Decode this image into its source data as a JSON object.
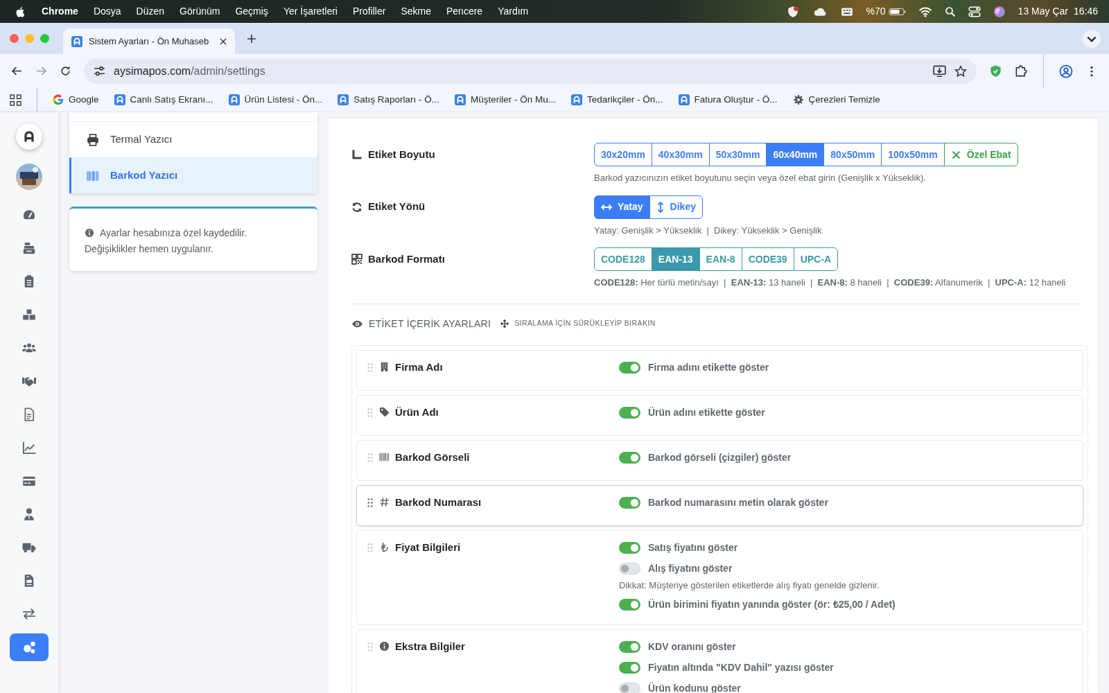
{
  "menubar": {
    "app": "Chrome",
    "menus": [
      "Dosya",
      "Düzen",
      "Görünüm",
      "Geçmiş",
      "Yer İşaretleri",
      "Profiller",
      "Sekme",
      "Pencere",
      "Yardım"
    ],
    "battery": "%70",
    "date": "13 May Çar",
    "time": "16:46"
  },
  "browser": {
    "tab_title": "Sistem Ayarları - Ön Muhaseb",
    "url_host": "aysimapos.com",
    "url_path": "/admin/settings",
    "bookmarks": [
      {
        "label": "Google",
        "kind": "google"
      },
      {
        "label": "Canlı Satış Ekranı...",
        "kind": "app"
      },
      {
        "label": "Ürün Listesi - Ön...",
        "kind": "app"
      },
      {
        "label": "Satış Raporları - Ö...",
        "kind": "app"
      },
      {
        "label": "Müşteriler - Ön Mu...",
        "kind": "app"
      },
      {
        "label": "Tedarikçiler - Ön...",
        "kind": "app"
      },
      {
        "label": "Fatura Oluştur - Ö...",
        "kind": "app"
      },
      {
        "label": "Çerezleri Temizle",
        "kind": "settings"
      }
    ]
  },
  "sidebar": {
    "items": [
      {
        "selected": false
      },
      {
        "selected": false
      },
      {
        "selected": false
      },
      {
        "selected": false
      },
      {
        "selected": false
      },
      {
        "selected": false
      },
      {
        "selected": false
      },
      {
        "selected": false
      },
      {
        "selected": false
      },
      {
        "selected": false
      },
      {
        "selected": false
      },
      {
        "selected": false
      },
      {
        "selected": false
      },
      {
        "selected": true
      }
    ]
  },
  "settings_menu": {
    "items": [
      {
        "label": "Termal Yazıcı",
        "selected": false
      },
      {
        "label": "Barkod Yazıcı",
        "selected": true
      }
    ],
    "info": "Ayarlar hesabınıza özel kaydedilir. Değişiklikler hemen uygulanır."
  },
  "label_settings": [
    {
      "label": "Etiket Boyutu",
      "hint": "Barkod yazıcınızın etiket boyutunu seçin veya özel ebat girin (Genişlik x Yükseklik).",
      "options": [
        {
          "label": "30x20mm",
          "kind": "size",
          "selected": false
        },
        {
          "label": "40x30mm",
          "kind": "size",
          "selected": false
        },
        {
          "label": "50x30mm",
          "kind": "size",
          "selected": false
        },
        {
          "label": "60x40mm",
          "kind": "size",
          "selected": true
        },
        {
          "label": "80x50mm",
          "kind": "size",
          "selected": false
        },
        {
          "label": "100x50mm",
          "kind": "size",
          "selected": false
        },
        {
          "label": "Özel Ebat",
          "kind": "custom",
          "selected": false
        }
      ]
    },
    {
      "label": "Etiket Yönü",
      "hint": "Yatay: Genişlik > Yükseklik  |  Dikey: Yükseklik > Genişlik",
      "options": [
        {
          "label": "Yatay",
          "selected": true
        },
        {
          "label": "Dikey",
          "selected": false
        }
      ]
    },
    {
      "label": "Barkod Formatı",
      "hint": "**CODE128:** Her türlü metin/sayı  |  **EAN-13:** 13 haneli  |  **EAN-8:** 8 haneli  |  **CODE39:** Alfanumerik  |  **UPC-A:** 12 haneli",
      "options": [
        {
          "label": "CODE128",
          "selected": false
        },
        {
          "label": "EAN-13",
          "selected": true
        },
        {
          "label": "EAN-8",
          "selected": false
        },
        {
          "label": "CODE39",
          "selected": false
        },
        {
          "label": "UPC-A",
          "selected": false
        }
      ]
    }
  ],
  "content": {
    "title": "ETİKET İÇERİK AYARLARI",
    "hint": "SIRALAMA İÇİN SÜRÜKLEYİP BIRAKIN",
    "fields": [
      {
        "label": "Firma Adı",
        "selected": false,
        "options": [
          {
            "kind": "toggle",
            "label": "Firma adını etikette göster",
            "on": true
          }
        ]
      },
      {
        "label": "Ürün Adı",
        "selected": false,
        "options": [
          {
            "kind": "toggle",
            "label": "Ürün adını etikette göster",
            "on": true
          }
        ]
      },
      {
        "label": "Barkod Görseli",
        "selected": false,
        "options": [
          {
            "kind": "toggle",
            "label": "Barkod görseli (çizgiler) göster",
            "on": true
          }
        ]
      },
      {
        "label": "Barkod Numarası",
        "selected": true,
        "options": [
          {
            "kind": "toggle",
            "label": "Barkod numarasını metin olarak göster",
            "on": true
          }
        ]
      },
      {
        "label": "Fiyat Bilgileri",
        "selected": false,
        "options": [
          {
            "kind": "toggle",
            "label": "Satış fiyatını göster",
            "on": true
          },
          {
            "kind": "toggle",
            "label": "Alış fiyatını göster",
            "on": false
          },
          {
            "kind": "note",
            "label": "Dikkat: Müşteriye gösterilen etiketlerde alış fiyatı genelde gizlenir."
          },
          {
            "kind": "toggle",
            "label": "Ürün birimini fiyatın yanında göster (ör: ₺25,00 / Adet)",
            "on": true
          }
        ]
      },
      {
        "label": "Ekstra Bilgiler",
        "selected": false,
        "options": [
          {
            "kind": "toggle",
            "label": "KDV oranını göster",
            "on": true
          },
          {
            "kind": "toggle",
            "label": "Fiyatın altında \"KDV Dahil\" yazısı göster",
            "on": true
          },
          {
            "kind": "toggle",
            "label": "Ürün kodunu göster",
            "on": false
          }
        ]
      }
    ]
  }
}
